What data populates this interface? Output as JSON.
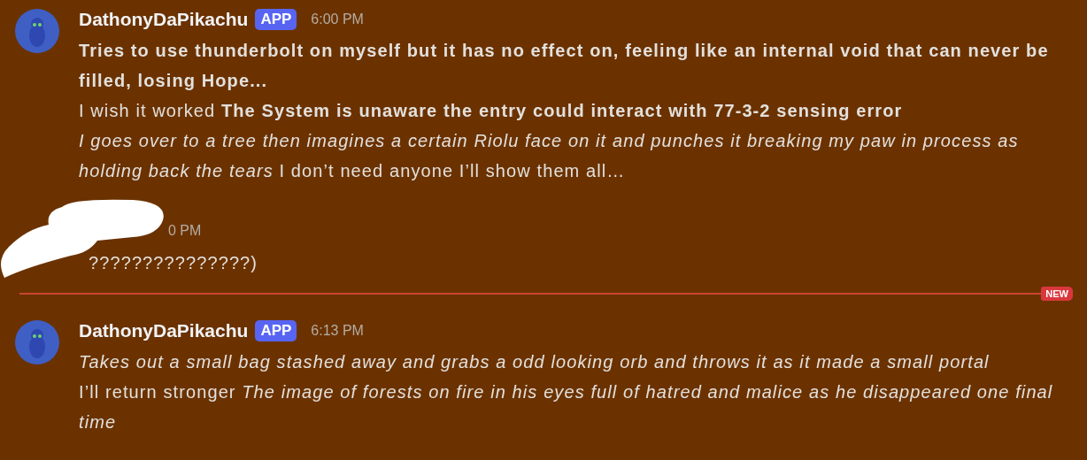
{
  "messages": [
    {
      "kind": "full",
      "author": "DathonyDaPikachu",
      "badge": "APP",
      "time": "6:00 PM",
      "paragraphs": [
        {
          "bold": true,
          "text": "Tries to use thunderbolt on myself but it has no effect on, feeling like an internal void that can never be filled, losing Hope..."
        },
        {
          "bold": false,
          "text": "I wish it worked **The System is unaware the entry could interact with 77-3-2 sensing error**"
        },
        {
          "bold": false,
          "text": "*I goes over to a tree then imagines a certain Riolu face on it and punches it breaking my paw in process as holding back the tears* I don’t need anyone I’ll show them all…"
        }
      ]
    },
    {
      "kind": "redacted",
      "time": "0 PM",
      "paragraphs": [
        {
          "bold": false,
          "text": "???????????????)"
        }
      ]
    },
    {
      "kind": "divider",
      "label": "NEW"
    },
    {
      "kind": "full",
      "author": "DathonyDaPikachu",
      "badge": "APP",
      "time": "6:13 PM",
      "paragraphs": [
        {
          "bold": false,
          "text": "*Takes out a small bag stashed away and grabs a odd looking orb and throws it as it made a small portal*"
        },
        {
          "bold": false,
          "text": "I’ll return stronger *The image of forests on fire in his eyes full of hatred and malice as he disappeared one final time*"
        }
      ]
    }
  ]
}
